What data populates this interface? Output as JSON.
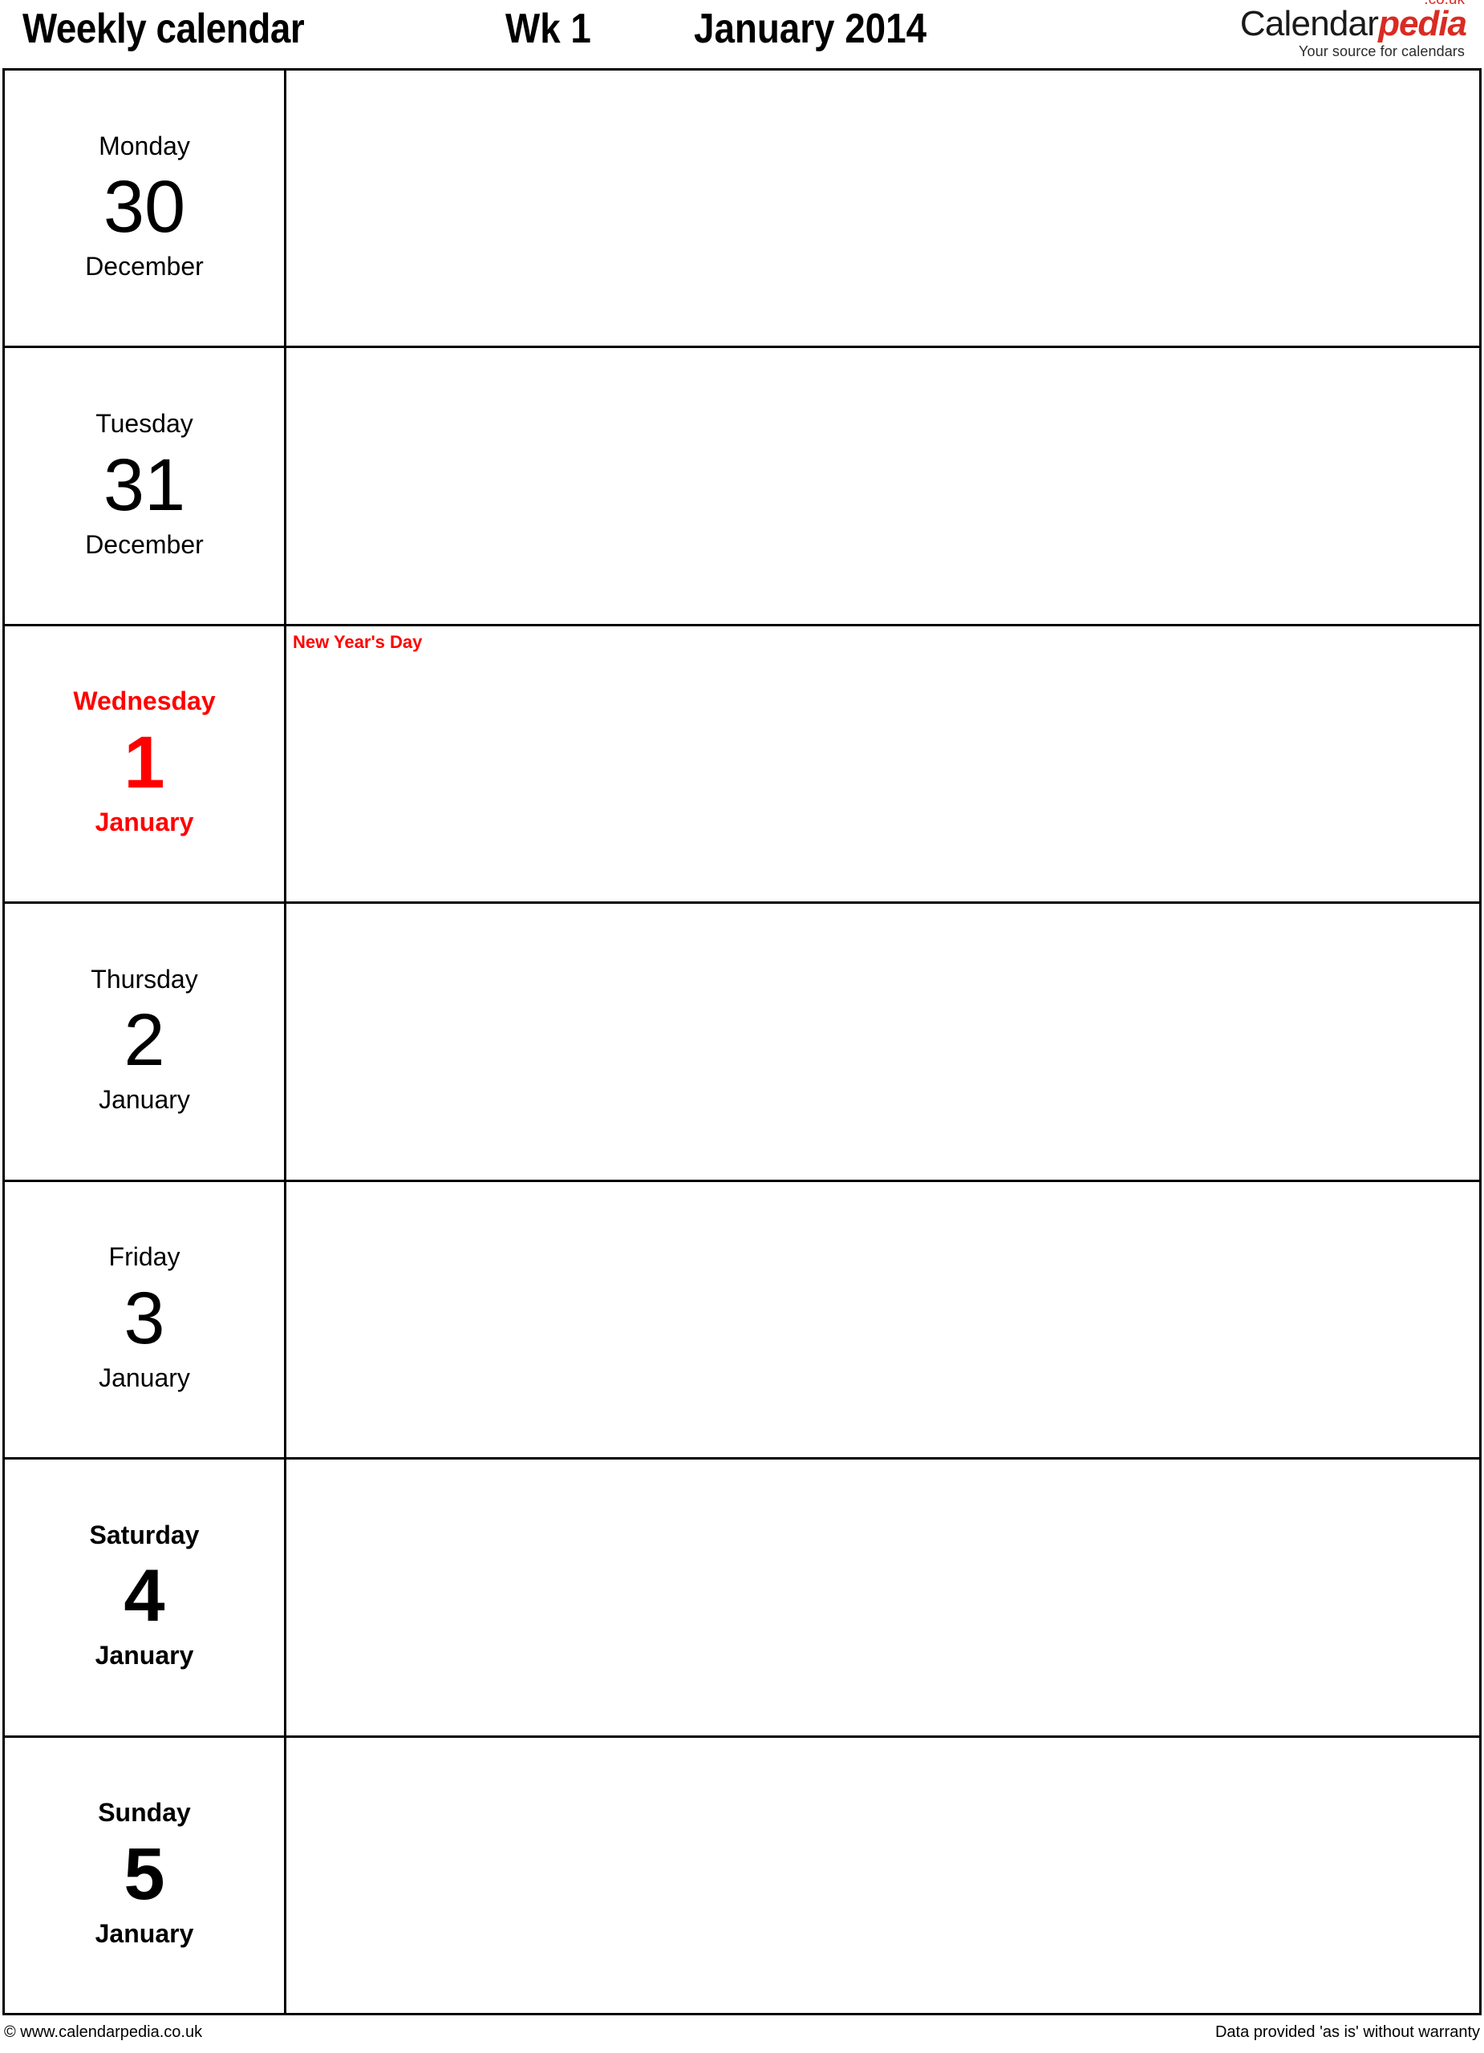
{
  "header": {
    "title": "Weekly calendar",
    "week_label": "Wk 1",
    "month_year": "January 2014"
  },
  "logo": {
    "name_part1": "Calendar",
    "name_part2": "pedia",
    "domain_suffix": ".co.uk",
    "tagline": "Your source for calendars",
    "accent_color": "#d92b23"
  },
  "colors": {
    "holiday": "#ff0000",
    "text": "#000000",
    "border": "#000000",
    "background": "#ffffff"
  },
  "days": [
    {
      "weekday": "Monday",
      "number": "30",
      "month": "December",
      "style": "weekday",
      "note": ""
    },
    {
      "weekday": "Tuesday",
      "number": "31",
      "month": "December",
      "style": "weekday",
      "note": ""
    },
    {
      "weekday": "Wednesday",
      "number": "1",
      "month": "January",
      "style": "holiday",
      "note": "New Year's Day"
    },
    {
      "weekday": "Thursday",
      "number": "2",
      "month": "January",
      "style": "weekday",
      "note": ""
    },
    {
      "weekday": "Friday",
      "number": "3",
      "month": "January",
      "style": "weekday",
      "note": ""
    },
    {
      "weekday": "Saturday",
      "number": "4",
      "month": "January",
      "style": "weekend",
      "note": ""
    },
    {
      "weekday": "Sunday",
      "number": "5",
      "month": "January",
      "style": "weekend",
      "note": ""
    }
  ],
  "footer": {
    "copyright": "© www.calendarpedia.co.uk",
    "disclaimer": "Data provided 'as is' without warranty"
  }
}
